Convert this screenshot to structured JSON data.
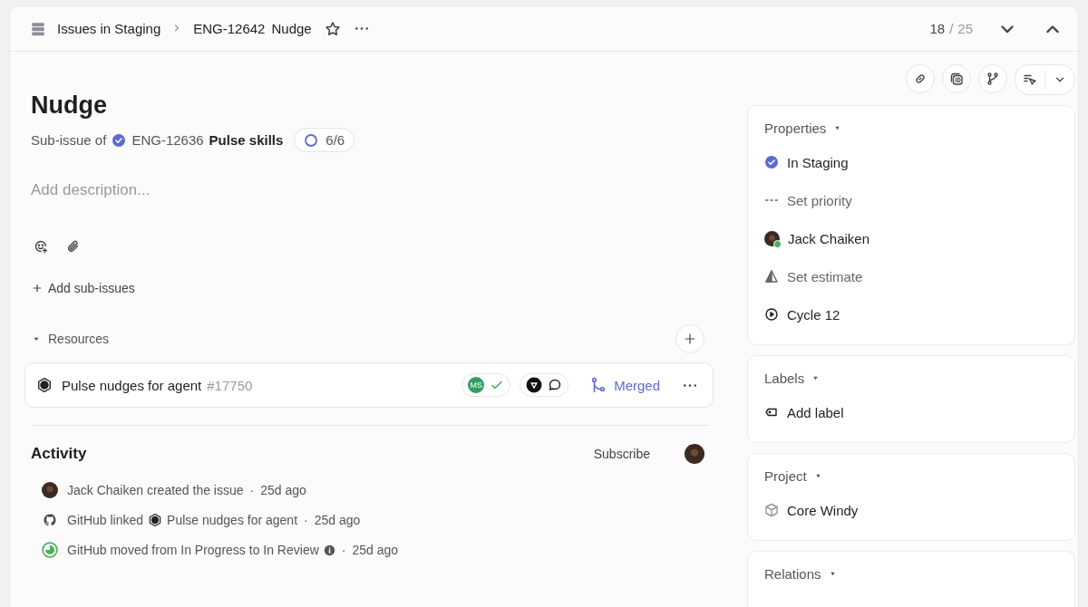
{
  "header": {
    "breadcrumb_parent": "Issues in Staging",
    "issue_id": "ENG-12642",
    "issue_title": "Nudge",
    "position": {
      "current": "18",
      "separator": "/",
      "total": "25"
    }
  },
  "issue": {
    "title": "Nudge",
    "parent_label": "Sub-issue of",
    "parent_id": "ENG-12636",
    "parent_title": "Pulse skills",
    "progress": "6/6",
    "description": {
      "placeholder": "Add description..."
    }
  },
  "add_sub_issues": "Add sub-issues",
  "resources": {
    "title": "Resources",
    "items": [
      {
        "title": "Pulse nudges for agent",
        "number": "#17750",
        "reviewer_initials": "MS",
        "approved": true,
        "status": "Merged"
      }
    ]
  },
  "activity": {
    "title": "Activity",
    "subscribe": "Subscribe",
    "separator": "·",
    "events": [
      {
        "kind": "user",
        "text": "Jack Chaiken created the issue",
        "time": "25d ago"
      },
      {
        "kind": "github",
        "text": "GitHub linked",
        "link": "Pulse nudges for agent",
        "time": "25d ago"
      },
      {
        "kind": "status",
        "text": "GitHub moved from In Progress to In Review",
        "info": true,
        "time": "25d ago"
      }
    ]
  },
  "sidebar": [
    {
      "title": "Properties",
      "items": [
        {
          "kind": "status",
          "label": "In Staging",
          "empty": false
        },
        {
          "kind": "priority",
          "label": "Set priority",
          "empty": true
        },
        {
          "kind": "assignee",
          "label": "Jack Chaiken",
          "empty": false,
          "online": true
        },
        {
          "kind": "estimate",
          "label": "Set estimate",
          "empty": true
        },
        {
          "kind": "cycle",
          "label": "Cycle 12",
          "empty": false
        }
      ]
    },
    {
      "title": "Labels",
      "items": [
        {
          "kind": "label",
          "label": "Add label",
          "empty": false
        }
      ]
    },
    {
      "title": "Project",
      "items": [
        {
          "kind": "project",
          "label": "Core Windy",
          "empty": false
        }
      ]
    },
    {
      "title": "Relations"
    }
  ]
}
